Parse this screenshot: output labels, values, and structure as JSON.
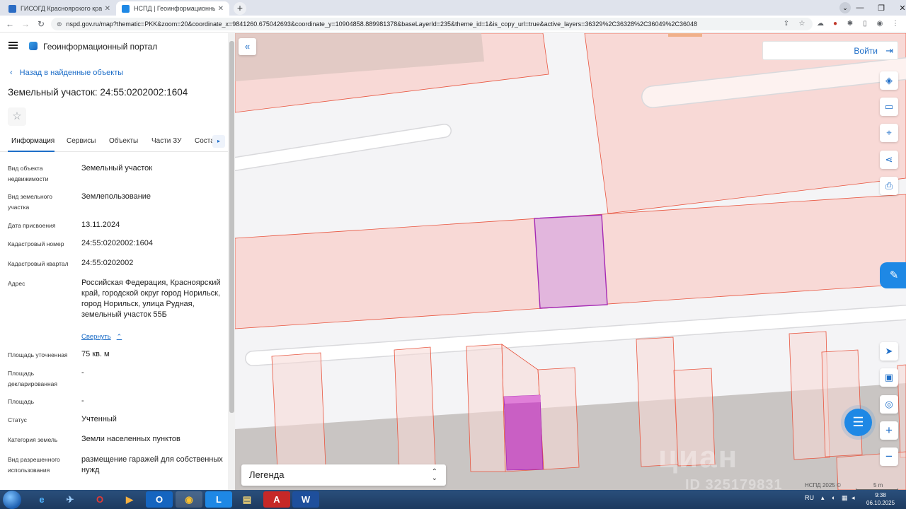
{
  "browser": {
    "tabs": [
      {
        "title": "ГИСОГД Красноярского края",
        "active": false
      },
      {
        "title": "НСПД | Геоинформационный п...",
        "active": true
      }
    ],
    "url": "nspd.gov.ru/map?thematic=PKK&zoom=20&coordinate_x=9841260.675042693&coordinate_y=10904858.889981378&baseLayerId=235&theme_id=1&is_copy_url=true&active_layers=36329%2C36328%2C36049%2C36048"
  },
  "portal": {
    "title": "Геоинформационный портал"
  },
  "panel": {
    "back_label": "Назад в найденные объекты",
    "object_title": "Земельный участок: 24:55:0202002:1604",
    "tabs": [
      "Информация",
      "Сервисы",
      "Объекты",
      "Части ЗУ",
      "Соста..."
    ],
    "properties": [
      {
        "label": "Вид объекта недвижимости",
        "value": "Земельный участок"
      },
      {
        "label": "Вид земельного участка",
        "value": "Землепользование"
      },
      {
        "label": "Дата присвоения",
        "value": "13.11.2024"
      },
      {
        "label": "Кадастровый номер",
        "value": "24:55:0202002:1604"
      },
      {
        "label": "Кадастровый квартал",
        "value": "24:55:0202002"
      },
      {
        "label": "Адрес",
        "value": "Российская Федерация, Красноярский край, городской округ город Норильск, город Норильск, улица Рудная, земельный участок 55Б"
      },
      {
        "label": "Площадь уточненная",
        "value": "75 кв. м"
      },
      {
        "label": "Площадь декларированная",
        "value": "-"
      },
      {
        "label": "Площадь",
        "value": "-"
      },
      {
        "label": "Статус",
        "value": "Учтенный"
      },
      {
        "label": "Категория земель",
        "value": "Земли населенных пунктов"
      },
      {
        "label": "Вид разрешенного использования",
        "value": "размещение гаражей для собственных нужд"
      }
    ],
    "collapse_label": "Свернуть"
  },
  "map": {
    "login_label": "Войти",
    "legend_label": "Легенда",
    "watermark": "циан",
    "watermark_id": "ID 325179831",
    "copyright": "НСПД 2025 ©",
    "scale": "5 m",
    "colors": {
      "parcel_fill": "#f8d9d6",
      "parcel_stroke": "#e8553f",
      "selected_fill": "#e2b6dd",
      "selected_stroke": "#a52ab4",
      "selected_dark": "#c95fc4",
      "accent": "#1e88e5"
    }
  },
  "taskbar": {
    "lang": "RU",
    "time": "9:38",
    "date": "06.10.2025"
  }
}
